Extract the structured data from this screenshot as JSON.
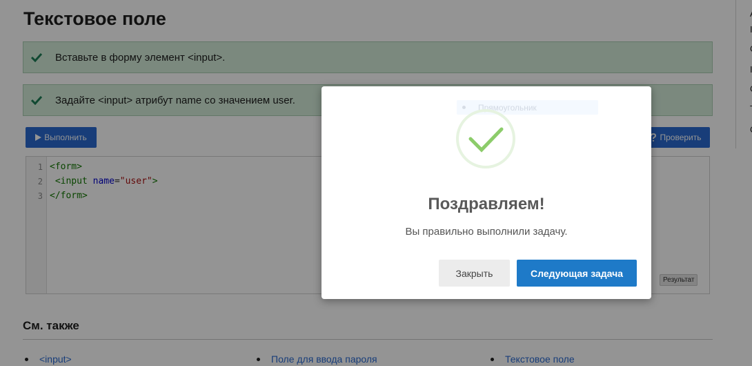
{
  "page": {
    "title": "Текстовое поле"
  },
  "tasks": [
    {
      "text": "Вставьте в форму элемент <input>.",
      "icon": "check-icon"
    },
    {
      "text": "Задайте <input> атрибут name со значением user.",
      "icon": "check-icon"
    }
  ],
  "toolbar": {
    "run_label": "Выполнить",
    "run_icon": "play-icon",
    "check_label": "Проверить",
    "check_icon": "question-icon"
  },
  "editor": {
    "line_numbers": [
      "1",
      "2",
      "3"
    ],
    "lines": {
      "l1_tag": "<form>",
      "l2_indent": " ",
      "l2_tag_open": "<input ",
      "l2_attr": "name",
      "l2_eq": "=",
      "l2_value": "\"user\"",
      "l2_tag_close": ">",
      "l3_tag": "</form>"
    },
    "result_label": "Результат"
  },
  "see_also": {
    "title": "См. также",
    "links": [
      "<input>",
      "Поле для ввода пароля",
      "Текстовое поле"
    ]
  },
  "side_panel": {
    "chars": [
      "A",
      "I",
      "C",
      "I",
      "C",
      "T",
      "C"
    ]
  },
  "modal": {
    "ghost_text": "Прямоугольник",
    "title": "Поздравляем!",
    "text": "Вы правильно выполнили задачу.",
    "close_label": "Закрыть",
    "next_label": "Следующая задача",
    "icon": "success-check-icon"
  },
  "colors": {
    "task_bg": "#d4edda",
    "check_green": "#1e7e57",
    "primary_blue": "#2a6ad1",
    "next_blue": "#1e7ac8",
    "success_green": "#8ccc6a"
  }
}
